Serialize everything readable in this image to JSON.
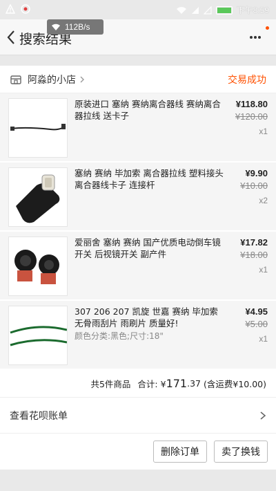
{
  "status_bar": {
    "time": "下午8:59",
    "net_speed": "112B/s"
  },
  "nav": {
    "title": "搜索结果"
  },
  "order": {
    "shop_name": "阿淼的小店",
    "status": "交易成功",
    "items": [
      {
        "title": "原装进口 塞纳 赛纳离合器线 赛纳离合器拉线 送卡子",
        "spec": "",
        "price": "¥118.80",
        "original_price": "¥120.00",
        "qty": "x1"
      },
      {
        "title": "塞纳 赛纳 毕加索 离合器拉线 塑料接头 离合器线卡子 连接杆",
        "spec": "",
        "price": "¥9.90",
        "original_price": "¥10.00",
        "qty": "x2"
      },
      {
        "title": "爱丽舍 塞纳 赛纳 国产优质电动倒车镜开关 后视镜开关 副产件",
        "spec": "",
        "price": "¥17.82",
        "original_price": "¥18.00",
        "qty": "x1"
      },
      {
        "title": "307 206 207 凯旋 世嘉 赛纳 毕加索 无骨雨刮片 雨刷片 质量好!",
        "spec": "颜色分类:黑色;尺寸:18\"",
        "price": "¥4.95",
        "original_price": "¥5.00",
        "qty": "x1"
      }
    ],
    "summary": {
      "count_text": "共5件商品",
      "total_label": "合计: ¥",
      "total_int": "171",
      "total_dec": ".37",
      "shipping": "(含运费¥10.00)"
    },
    "bill_link": "查看花呗账单",
    "buttons": {
      "delete": "删除订单",
      "sell": "卖了换钱"
    }
  },
  "thumb_watermark": "阿淼的小店"
}
